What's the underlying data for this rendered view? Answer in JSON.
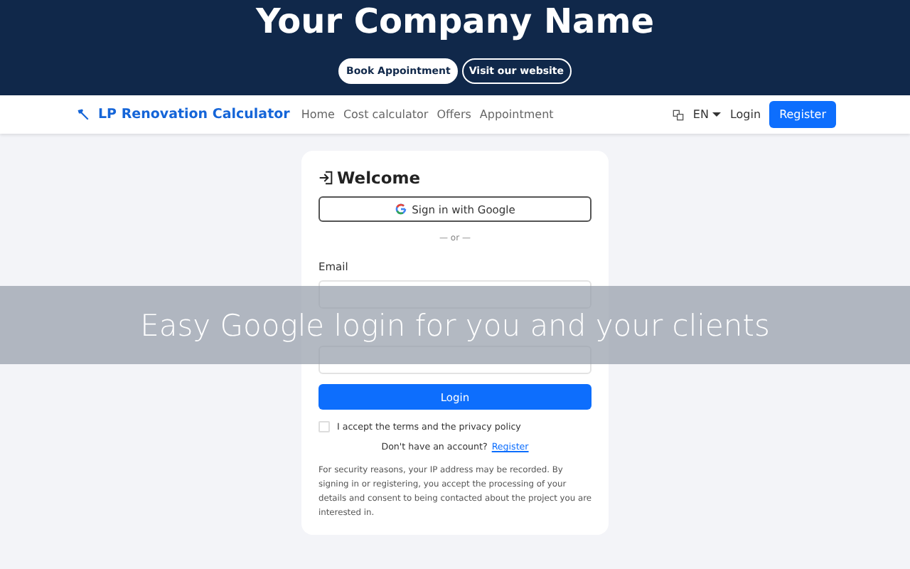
{
  "header": {
    "title": "Your Company Name",
    "buttons": [
      {
        "label": "Book Appointment",
        "kind": "filled"
      },
      {
        "label": "Visit our website",
        "kind": "outline"
      }
    ]
  },
  "navbar": {
    "brand": "LP Renovation Calculator",
    "links": [
      "Home",
      "Cost calculator",
      "Offers",
      "Appointment"
    ],
    "language": "EN",
    "login": "Login",
    "register": "Register"
  },
  "card": {
    "title": "Welcome",
    "google_button": "Sign in with Google",
    "divider": "— or —",
    "email_label": "Email",
    "login_button": "Login",
    "terms": {
      "label": "I accept the terms and the privacy policy",
      "checked": false
    },
    "signup_prompt": "Don't have an account?",
    "signup_link": "Register",
    "notice": "For security reasons, your IP address may be recorded. By signing in or registering, you accept the processing of your details and consent to being contacted about the project you are interested in."
  },
  "banner": {
    "text": "Easy Google login for you and your clients"
  }
}
